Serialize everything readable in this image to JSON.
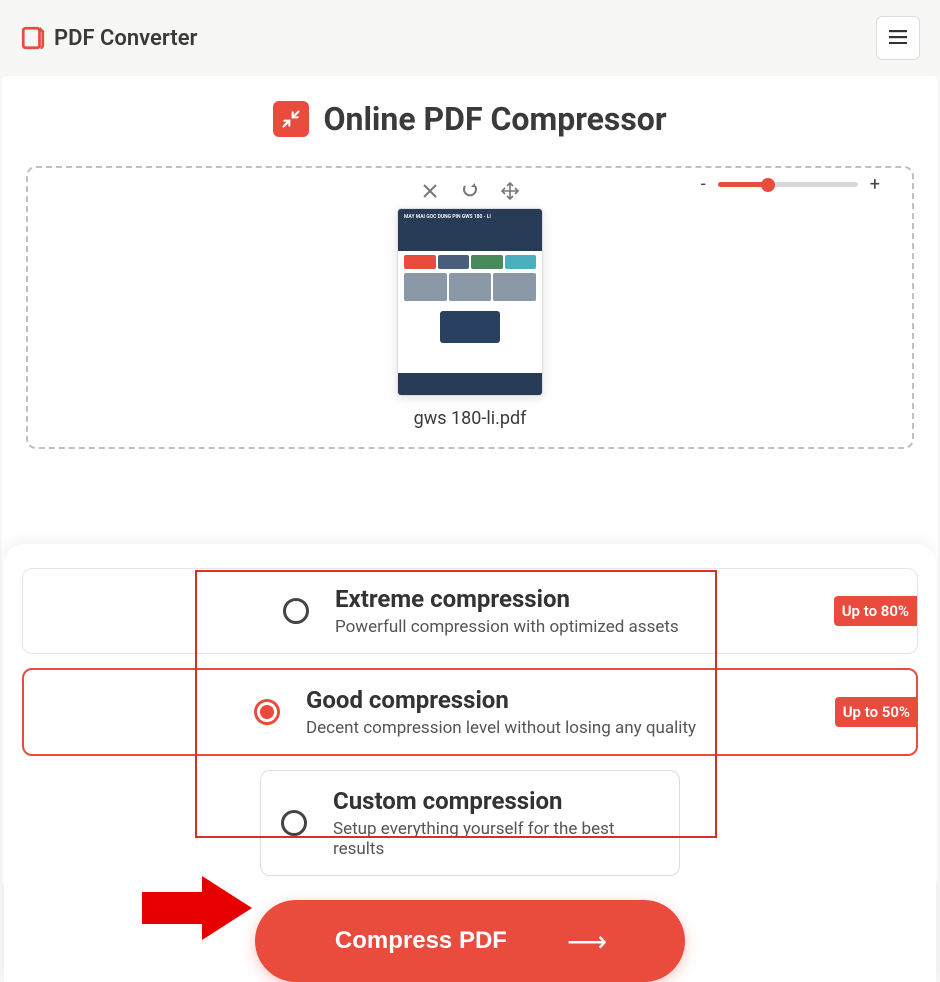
{
  "header": {
    "brand": "PDF Converter"
  },
  "page": {
    "title": "Online PDF Compressor"
  },
  "file": {
    "name": "gws 180-li.pdf"
  },
  "zoom": {
    "minus": "-",
    "plus": "+"
  },
  "options": [
    {
      "id": "extreme",
      "title": "Extreme compression",
      "subtitle": "Powerfull compression with optimized assets",
      "badge": "Up to 80%",
      "selected": false
    },
    {
      "id": "good",
      "title": "Good compression",
      "subtitle": "Decent compression level without losing any quality",
      "badge": "Up to 50%",
      "selected": true
    },
    {
      "id": "custom",
      "title": "Custom compression",
      "subtitle": "Setup everything yourself for the best results",
      "badge": null,
      "selected": false
    }
  ],
  "cta": {
    "label": "Compress PDF"
  }
}
